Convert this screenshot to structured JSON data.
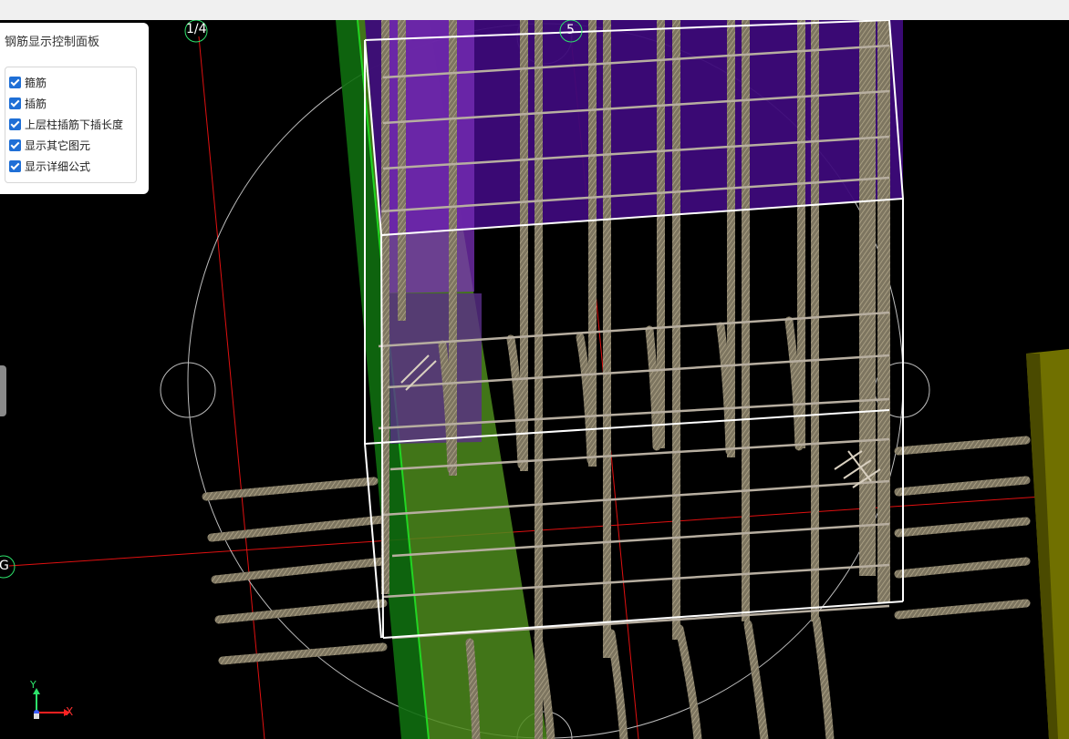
{
  "panel": {
    "title": "钢筋显示控制面板",
    "options": [
      {
        "label": "箍筋",
        "checked": true
      },
      {
        "label": "插筋",
        "checked": true
      },
      {
        "label": "上层柱插筋下插长度",
        "checked": true
      },
      {
        "label": "显示其它图元",
        "checked": true
      },
      {
        "label": "显示详细公式",
        "checked": true
      }
    ]
  },
  "axes": {
    "grid_1_4": "1/4",
    "grid_5": "5",
    "grid_g": "G"
  },
  "triad": {
    "y_label": "Y",
    "x_label": "X"
  },
  "colors": {
    "background": "#000000",
    "column_purple": "#4a148c",
    "wall_green": "#3f7f1a",
    "beam_olive": "#6b6b00",
    "rebar": "#9b9177",
    "outline": "#ffffff",
    "grid_line": "#ff1a1a",
    "checkbox": "#1f6fd6"
  }
}
